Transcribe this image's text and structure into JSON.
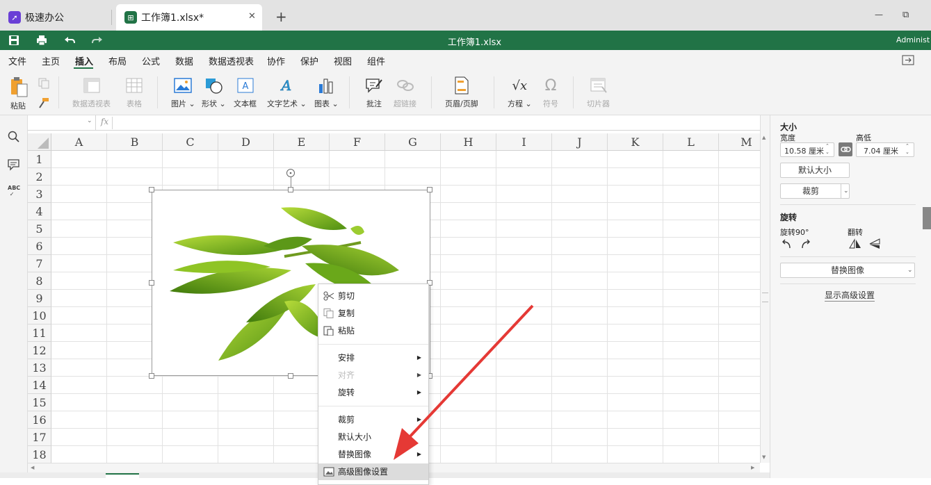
{
  "tabs": [
    {
      "label": "极速办公"
    },
    {
      "label": "工作簿1.xlsx*",
      "close": "✕"
    }
  ],
  "new_tab": "+",
  "window_controls": {
    "minimize": "—",
    "restore": "⧉"
  },
  "titlebar": {
    "title": "工作簿1.xlsx",
    "user": "Administ"
  },
  "menu": [
    "文件",
    "主页",
    "插入",
    "布局",
    "公式",
    "数据",
    "数据透视表",
    "协作",
    "保护",
    "视图",
    "组件"
  ],
  "active_menu": "插入",
  "ribbon": {
    "paste": "粘贴",
    "pivot": "数据透视表",
    "table": "表格",
    "picture": "图片",
    "shape": "形状",
    "textbox": "文本框",
    "wordart": "文字艺术",
    "chart": "图表",
    "comment": "批注",
    "hyperlink": "超链接",
    "header_footer": "页眉/页脚",
    "equation": "方程",
    "symbol": "符号",
    "slicer": "切片器"
  },
  "formula": {
    "fx": "fx"
  },
  "columns": [
    "A",
    "B",
    "C",
    "D",
    "E",
    "F",
    "G",
    "H",
    "I",
    "J",
    "K",
    "L",
    "M"
  ],
  "rows": [
    "1",
    "2",
    "3",
    "4",
    "5",
    "6",
    "7",
    "8",
    "9",
    "10",
    "11",
    "12",
    "13",
    "14",
    "15",
    "16",
    "17",
    "18"
  ],
  "context_menu": {
    "cut": "剪切",
    "copy": "复制",
    "paste": "粘贴",
    "arrange": "安排",
    "align": "对齐",
    "rotate": "旋转",
    "crop": "裁剪",
    "default_size": "默认大小",
    "replace_image": "替换图像",
    "advanced": "高级图像设置"
  },
  "panel": {
    "size_title": "大小",
    "width_label": "宽度",
    "height_label": "高低",
    "width_value": "10.58 厘米",
    "height_value": "7.04 厘米",
    "default_size": "默认大小",
    "crop": "裁剪",
    "rotation_title": "旋转",
    "rotate90": "旋转90°",
    "flip": "翻转",
    "replace_image": "替换图像",
    "advanced": "显示高级设置"
  },
  "colors": {
    "brand": "#217346",
    "arrow": "#e53935"
  }
}
